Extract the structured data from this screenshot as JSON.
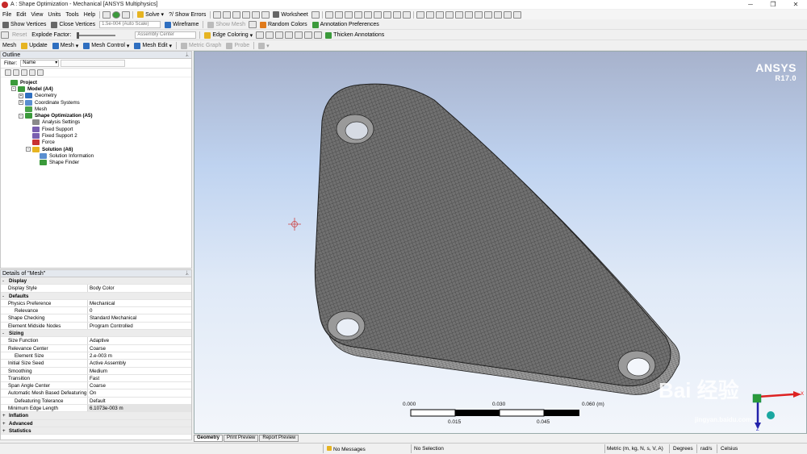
{
  "window": {
    "title": "A : Shape Optimization - Mechanical [ANSYS Multiphysics]",
    "minimize": "─",
    "restore": "❐",
    "close": "✕"
  },
  "menus": [
    "File",
    "Edit",
    "View",
    "Units",
    "Tools",
    "Help"
  ],
  "toolbar1": {
    "solve": "Solve",
    "show_errors": "?/ Show Errors",
    "worksheet": "Worksheet"
  },
  "toolbar2": {
    "show_vertices": "Show Vertices",
    "close_vertices": "Close Vertices",
    "auto_scale": "1.5e-004 (Auto Scale)",
    "wireframe": "Wireframe",
    "show_mesh": "Show Mesh",
    "random_colors": "Random Colors",
    "annotation_preferences": "Annotation Preferences"
  },
  "toolbar3": {
    "reset": "Reset",
    "explode_factor": "Explode Factor:",
    "assembly_center": "Assembly Center",
    "edge_coloring": "Edge Coloring",
    "thicken_annotations": "Thicken Annotations"
  },
  "toolbar4": {
    "mesh": "Mesh",
    "update": "Update",
    "mesh_menu": "Mesh",
    "mesh_control": "Mesh Control",
    "mesh_edit": "Mesh Edit",
    "metric_graph": "Metric Graph",
    "probe": "Probe"
  },
  "outline": {
    "title": "Outline",
    "filter_label": "Filter:",
    "filter_value": "Name",
    "tree": [
      {
        "label": "Project",
        "level": 0,
        "bold": true,
        "exp": "",
        "color": "#3b9a3b"
      },
      {
        "label": "Model (A4)",
        "level": 1,
        "bold": true,
        "exp": "-",
        "color": "#3b9a3b"
      },
      {
        "label": "Geometry",
        "level": 2,
        "bold": false,
        "exp": "+",
        "color": "#2f6fc0"
      },
      {
        "label": "Coordinate Systems",
        "level": 2,
        "bold": false,
        "exp": "+",
        "color": "#5a8fd0"
      },
      {
        "label": "Mesh",
        "level": 2,
        "bold": false,
        "exp": "",
        "color": "#4aa34a"
      },
      {
        "label": "Shape Optimization (A5)",
        "level": 2,
        "bold": true,
        "exp": "-",
        "color": "#3b9a3b"
      },
      {
        "label": "Analysis Settings",
        "level": 3,
        "bold": false,
        "exp": "",
        "color": "#8a8a8a"
      },
      {
        "label": "Fixed Support",
        "level": 3,
        "bold": false,
        "exp": "",
        "color": "#7a5fb0"
      },
      {
        "label": "Fixed Support 2",
        "level": 3,
        "bold": false,
        "exp": "",
        "color": "#7a5fb0"
      },
      {
        "label": "Force",
        "level": 3,
        "bold": false,
        "exp": "",
        "color": "#c83232"
      },
      {
        "label": "Solution (A6)",
        "level": 3,
        "bold": true,
        "exp": "-",
        "color": "#e6b422"
      },
      {
        "label": "Solution Information",
        "level": 4,
        "bold": false,
        "exp": "",
        "color": "#5a8fd0"
      },
      {
        "label": "Shape Finder",
        "level": 4,
        "bold": false,
        "exp": "",
        "color": "#3b9a3b"
      }
    ]
  },
  "details": {
    "title": "Details of \"Mesh\"",
    "rows": [
      {
        "type": "sec",
        "k": "Display",
        "exp": "-"
      },
      {
        "k": "Display Style",
        "v": "Body Color"
      },
      {
        "type": "sec",
        "k": "Defaults",
        "exp": "-"
      },
      {
        "k": "Physics Preference",
        "v": "Mechanical"
      },
      {
        "k": "Relevance",
        "v": "0",
        "indent": true
      },
      {
        "k": "Shape Checking",
        "v": "Standard Mechanical"
      },
      {
        "k": "Element Midside Nodes",
        "v": "Program Controlled"
      },
      {
        "type": "sec",
        "k": "Sizing",
        "exp": "-"
      },
      {
        "k": "Size Function",
        "v": "Adaptive"
      },
      {
        "k": "Relevance Center",
        "v": "Coarse"
      },
      {
        "k": "Element Size",
        "v": "2.e-003 m",
        "indent": true
      },
      {
        "k": "Initial Size Seed",
        "v": "Active Assembly"
      },
      {
        "k": "Smoothing",
        "v": "Medium"
      },
      {
        "k": "Transition",
        "v": "Fast"
      },
      {
        "k": "Span Angle Center",
        "v": "Coarse"
      },
      {
        "k": "Automatic Mesh Based Defeaturing",
        "v": "On"
      },
      {
        "k": "Defeaturing Tolerance",
        "v": "Default",
        "indent": true
      },
      {
        "k": "Minimum Edge Length",
        "v": "6.1073e-003 m",
        "hl": true
      },
      {
        "type": "sec",
        "k": "Inflation",
        "exp": "+"
      },
      {
        "type": "sec",
        "k": "Advanced",
        "exp": "+"
      },
      {
        "type": "sec",
        "k": "Statistics",
        "exp": "+"
      }
    ]
  },
  "viewport": {
    "logo": "ANSYS",
    "version": "R17.0",
    "scale_top": [
      "0.000",
      "0.030",
      "0.060 (m)"
    ],
    "scale_bottom": [
      "0.015",
      "0.045"
    ],
    "triad_x": "X",
    "triad_z": "Z",
    "watermark": "Bai 经验",
    "watermark_url": "jingyan.baidu.com"
  },
  "tabs": [
    "Geometry",
    "Print Preview",
    "Report Preview"
  ],
  "status": {
    "messages": "No Messages",
    "selection": "No Selection",
    "units": "Metric (m, kg, N, s, V, A)",
    "angle": "Degrees",
    "rate": "rad/s",
    "temp": "Celsius"
  }
}
